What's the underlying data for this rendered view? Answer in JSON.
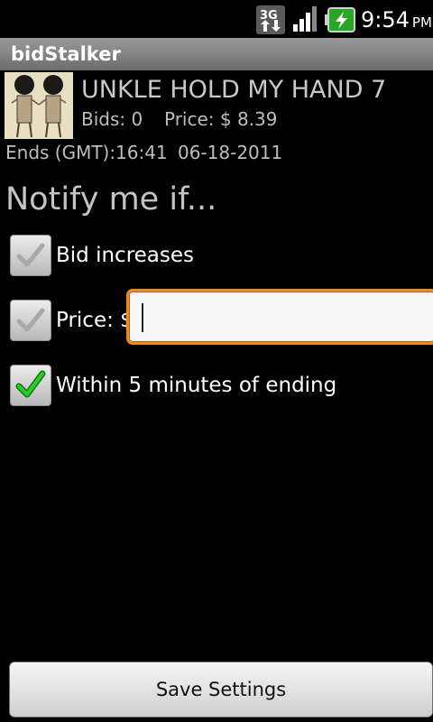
{
  "status_bar": {
    "network_type": "3G",
    "network_icon": "3g-data-icon",
    "signal_icon": "signal-strength-icon",
    "battery_icon": "battery-charging-icon",
    "time": "9:54",
    "ampm": "PM"
  },
  "app": {
    "title": "bidStalker"
  },
  "item": {
    "name": "UNKLE HOLD MY HAND 7",
    "bids_label": "Bids: 0",
    "price_label": "Price: $ 8.39",
    "ends_label": "Ends (GMT):",
    "ends_time": "16:41",
    "ends_date": "06-18-2011"
  },
  "notify": {
    "heading": "Notify me if...",
    "options": [
      {
        "label": "Bid increases",
        "checked": false
      },
      {
        "label": "Price: $",
        "checked": false
      },
      {
        "label": "Within 5 minutes of ending",
        "checked": true
      }
    ],
    "price_value": "",
    "price_placeholder": ""
  },
  "footer": {
    "save_label": "Save Settings"
  },
  "colors": {
    "accent_focus": "#f0891f",
    "check_green": "#22b022"
  }
}
